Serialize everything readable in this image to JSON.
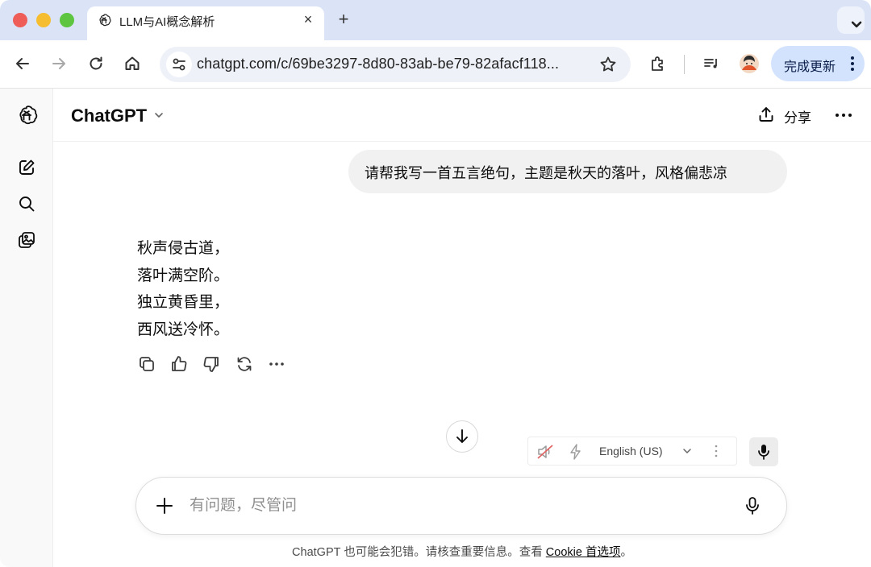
{
  "browser": {
    "tab_title": "LLM与AI概念解析",
    "tab_close": "×",
    "new_tab": "+",
    "url": "chatgpt.com/c/69be3297-8d80-83ab-be79-82afacf118...",
    "update_label": "完成更新"
  },
  "chat": {
    "model_name": "ChatGPT",
    "share_label": "分享",
    "user_message": "请帮我写一首五言绝句，主题是秋天的落叶，风格偏悲凉",
    "poem": [
      "秋声侵古道，",
      "落叶满空阶。",
      "独立黄昏里，",
      "西风送冷怀。"
    ],
    "voice_language": "English (US)",
    "composer_placeholder": "有问题，尽管问",
    "footer_text": "ChatGPT 也可能会犯错。请核查重要信息。查看 ",
    "footer_link": "Cookie 首选项",
    "footer_end": "。"
  },
  "icons": {
    "tab_favicon": "openai-logo-icon",
    "rail": [
      "openai-logo-icon",
      "new-chat-icon",
      "search-icon",
      "library-icon"
    ],
    "message_actions": [
      "copy-icon",
      "thumbs-up-icon",
      "thumbs-down-icon",
      "regenerate-icon",
      "more-icon"
    ]
  },
  "colors": {
    "tabstrip_bg": "#dbe4f7",
    "update_button_bg": "#d3e3fd",
    "user_bubble_bg": "#f1f1f1",
    "rail_bg": "#f9f9f9"
  }
}
